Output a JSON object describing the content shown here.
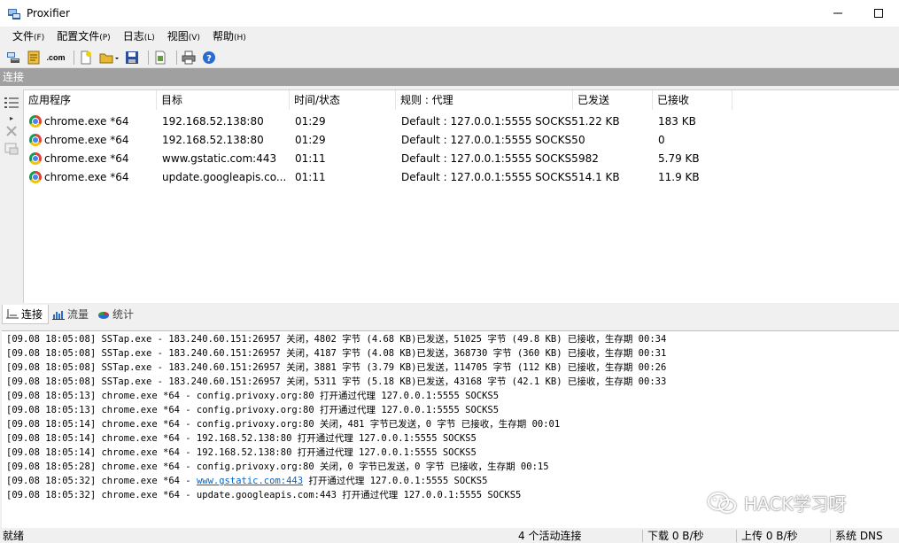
{
  "window": {
    "title": "Proxifier"
  },
  "menu": [
    {
      "label": "文件",
      "key": "(F)"
    },
    {
      "label": "配置文件",
      "key": "(P)"
    },
    {
      "label": "日志",
      "key": "(L)"
    },
    {
      "label": "视图",
      "key": "(V)"
    },
    {
      "label": "帮助",
      "key": "(H)"
    }
  ],
  "toolbar": {
    "com_label": ".com"
  },
  "section": {
    "title": "连接"
  },
  "columns": [
    "应用程序",
    "目标",
    "时间/状态",
    "规则 : 代理",
    "已发送",
    "已接收"
  ],
  "connections": [
    {
      "app": "chrome.exe *64",
      "target": "192.168.52.138:80",
      "time": "01:29",
      "rule": "Default : 127.0.0.1:5555 SOCKS5",
      "sent": "1.22 KB",
      "recv": "183 KB"
    },
    {
      "app": "chrome.exe *64",
      "target": "192.168.52.138:80",
      "time": "01:29",
      "rule": "Default : 127.0.0.1:5555 SOCKS5",
      "sent": "0",
      "recv": "0"
    },
    {
      "app": "chrome.exe *64",
      "target": "www.gstatic.com:443",
      "time": "01:11",
      "rule": "Default : 127.0.0.1:5555 SOCKS5",
      "sent": "982",
      "recv": "5.79 KB"
    },
    {
      "app": "chrome.exe *64",
      "target": "update.googleapis.co...",
      "time": "01:11",
      "rule": "Default : 127.0.0.1:5555 SOCKS5",
      "sent": "14.1 KB",
      "recv": "11.9 KB"
    }
  ],
  "tabs": [
    {
      "label": "连接",
      "icon": "connections-icon"
    },
    {
      "label": "流量",
      "icon": "traffic-chart-icon"
    },
    {
      "label": "统计",
      "icon": "statistics-pie-icon"
    }
  ],
  "log": [
    {
      "pre": "[09.08 18:05:08] SSTap.exe - 183.240.60.151:26957 关闭，4802 字节 (4.68 KB)已发送，51025 字节 (49.8 KB) 已接收，生存期 00:34"
    },
    {
      "pre": "[09.08 18:05:08] SSTap.exe - 183.240.60.151:26957 关闭，4187 字节 (4.08 KB)已发送，368730 字节 (360 KB) 已接收，生存期 00:31"
    },
    {
      "pre": "[09.08 18:05:08] SSTap.exe - 183.240.60.151:26957 关闭，3881 字节 (3.79 KB)已发送，114705 字节 (112 KB) 已接收，生存期 00:26"
    },
    {
      "pre": "[09.08 18:05:08] SSTap.exe - 183.240.60.151:26957 关闭，5311 字节 (5.18 KB)已发送，43168 字节 (42.1 KB) 已接收，生存期 00:33"
    },
    {
      "pre": "[09.08 18:05:13] chrome.exe *64 - config.privoxy.org:80 打开通过代理 127.0.0.1:5555 SOCKS5"
    },
    {
      "pre": "[09.08 18:05:13] chrome.exe *64 - config.privoxy.org:80 打开通过代理 127.0.0.1:5555 SOCKS5"
    },
    {
      "pre": "[09.08 18:05:14] chrome.exe *64 - config.privoxy.org:80 关闭，481 字节已发送，0 字节 已接收，生存期 00:01"
    },
    {
      "pre": "[09.08 18:05:14] chrome.exe *64 - 192.168.52.138:80 打开通过代理 127.0.0.1:5555 SOCKS5"
    },
    {
      "pre": "[09.08 18:05:14] chrome.exe *64 - 192.168.52.138:80 打开通过代理 127.0.0.1:5555 SOCKS5"
    },
    {
      "pre": "[09.08 18:05:28] chrome.exe *64 - config.privoxy.org:80 关闭，0 字节已发送，0 字节 已接收，生存期 00:15"
    },
    {
      "pre": "[09.08 18:05:32] chrome.exe *64 - ",
      "link": "www.gstatic.com:443",
      "post": " 打开通过代理 127.0.0.1:5555 SOCKS5"
    },
    {
      "pre": "[09.08 18:05:32] chrome.exe *64 - update.googleapis.com:443 打开通过代理 127.0.0.1:5555 SOCKS5"
    }
  ],
  "watermark": "HACK学习呀",
  "status": {
    "ready": "就绪",
    "active": "4 个活动连接",
    "down": "下载 0 B/秒",
    "up": "上传 0 B/秒",
    "dns": "系统 DNS"
  }
}
